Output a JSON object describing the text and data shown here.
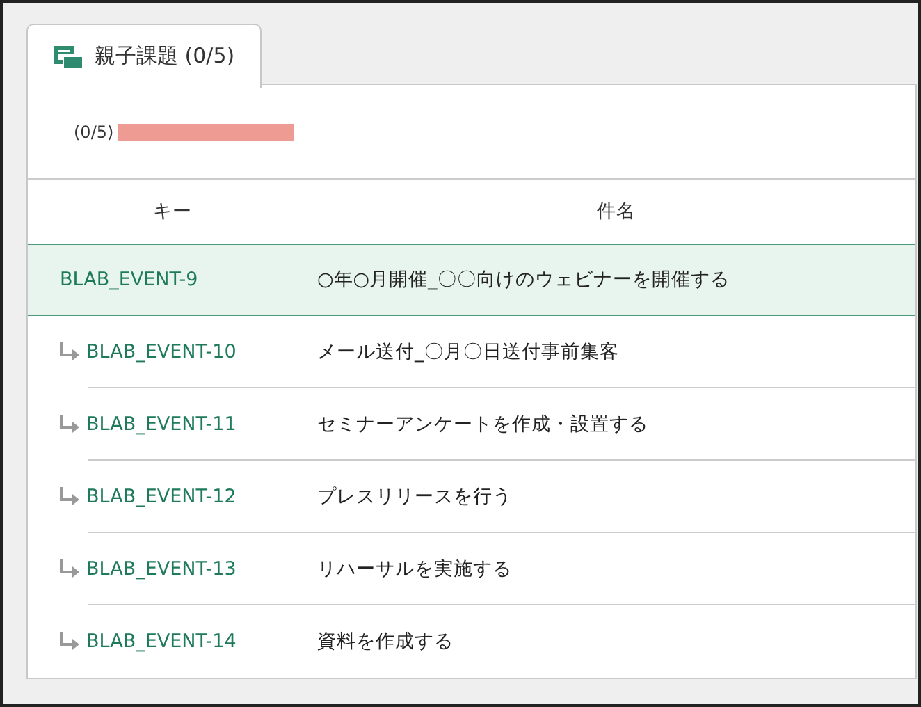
{
  "tabs": [
    {
      "label": "親子課題 (0/5)",
      "selected": true
    }
  ],
  "progress": {
    "reading": "(0/5)"
  },
  "table": {
    "columns": [
      "キー",
      "件名"
    ],
    "rows": [
      {
        "key": "BLAB_EVENT-9",
        "summary": "○年○月開催_〇〇向けのウェビナーを開催する",
        "selected": true,
        "children": [
          {
            "key": "BLAB_EVENT-10",
            "summary": "メール送付_〇月〇日送付事前集客",
            "selected": false
          },
          {
            "key": "BLAB_EVENT-11",
            "summary": "セミナーアンケートを作成・設置する",
            "selected": false
          },
          {
            "key": "BLAB_EVENT-12",
            "summary": "プレスリリースを行う",
            "selected": false
          },
          {
            "key": "BLAB_EVENT-13",
            "summary": "リハーサルを実施する",
            "selected": false
          },
          {
            "key": "BLAB_EVENT-14",
            "summary": "資料を作成する",
            "selected": false
          }
        ]
      }
    ]
  }
}
